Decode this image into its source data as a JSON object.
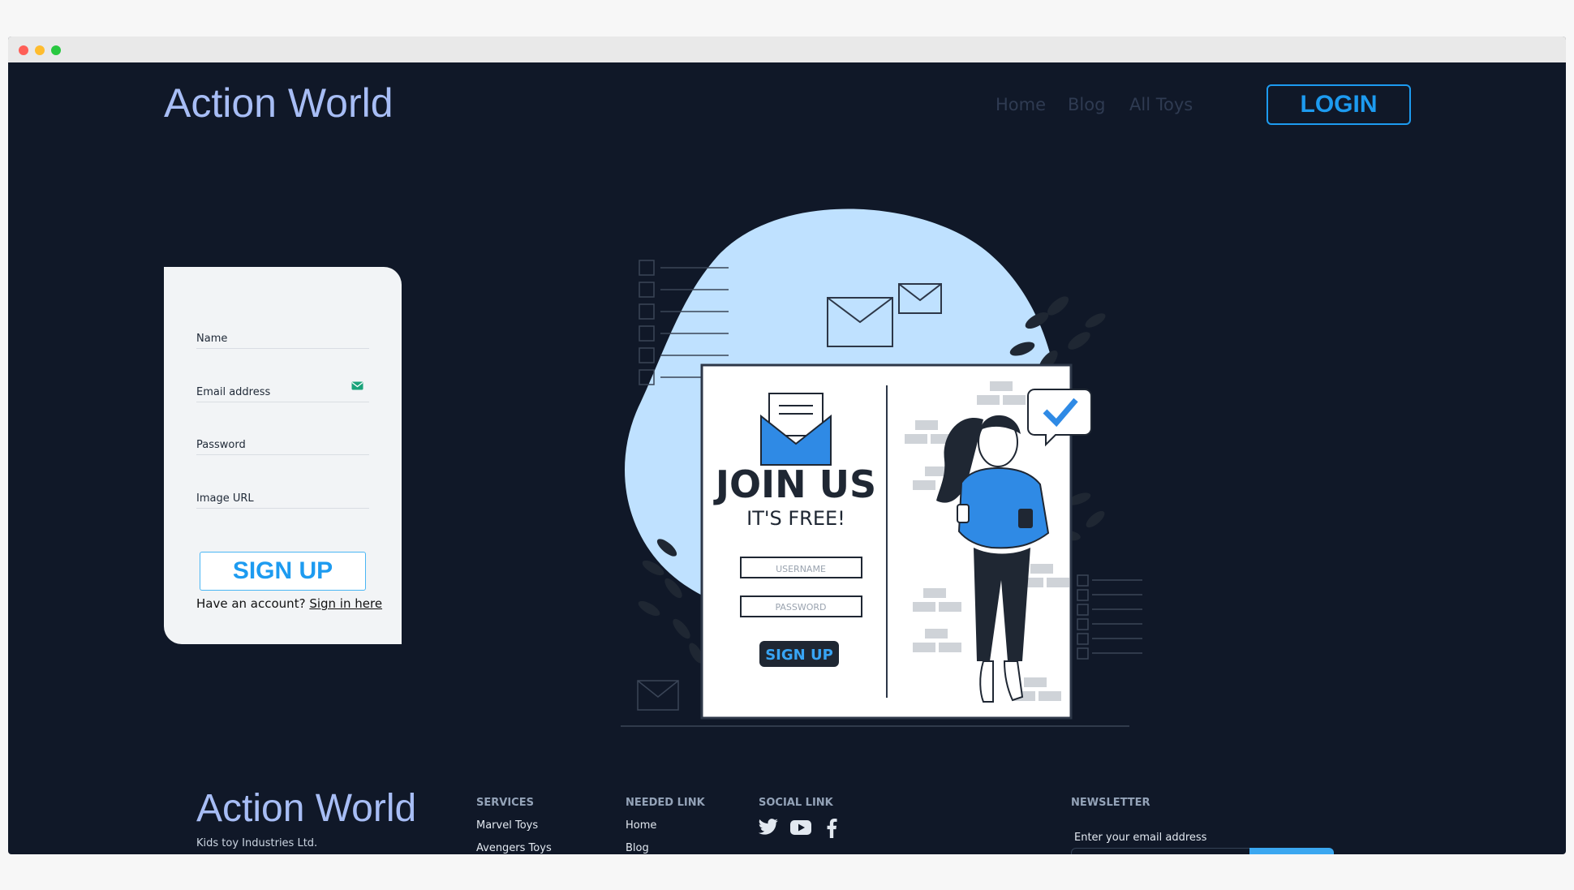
{
  "header": {
    "brand": "Action World",
    "nav": [
      "Home",
      "Blog",
      "All Toys"
    ],
    "login_label": "LOGIN"
  },
  "form": {
    "fields": [
      {
        "label": "Name"
      },
      {
        "label": "Email address"
      },
      {
        "label": "Password"
      },
      {
        "label": "Image URL"
      }
    ],
    "submit_label": "SIGN UP",
    "have_account": "Have an account?",
    "signin_link": "Sign in here"
  },
  "illustration": {
    "title": "JOIN US",
    "subtitle": "IT'S FREE!",
    "username_placeholder": "USERNAME",
    "password_placeholder": "PASSWORD",
    "button": "SIGN UP"
  },
  "footer": {
    "brand": "Action World",
    "tagline": "Kids toy Industries Ltd.",
    "services_heading": "SERVICES",
    "services": [
      "Marvel Toys",
      "Avengers Toys"
    ],
    "needed_heading": "NEEDED LINK",
    "needed": [
      "Home",
      "Blog"
    ],
    "social_heading": "SOCIAL LINK",
    "social_icons": [
      "twitter-icon",
      "youtube-icon",
      "facebook-icon"
    ],
    "newsletter_heading": "NEWSLETTER",
    "newsletter_label": "Enter your email address"
  },
  "colors": {
    "background": "#101828",
    "accent": "#1d9bf0",
    "brand": "#a7bdf5"
  }
}
